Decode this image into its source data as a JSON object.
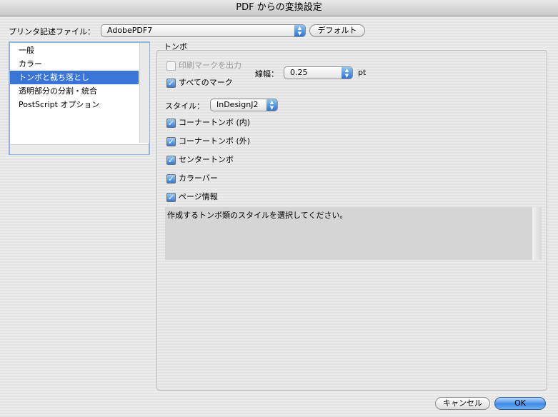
{
  "window": {
    "title": "PDF からの変換設定"
  },
  "printer": {
    "label": "プリンタ記述ファイル：",
    "selected": "AdobePDF7",
    "default_button": "デフォルト"
  },
  "sidebar": {
    "items": [
      {
        "label": "一般"
      },
      {
        "label": "カラー"
      },
      {
        "label": "トンボと裁ち落とし",
        "selected": true
      },
      {
        "label": "透明部分の分割・統合"
      },
      {
        "label": "PostScript オプション"
      }
    ]
  },
  "marks": {
    "group_title": "トンボ",
    "print_marks": {
      "label": "印刷マークを出力",
      "checked": false,
      "enabled": false
    },
    "all_marks": {
      "label": "すべてのマーク",
      "checked": true
    },
    "weight": {
      "label": "線幅：",
      "value": "0.25",
      "unit": "pt"
    },
    "style": {
      "label": "スタイル：",
      "value": "InDesignJ2"
    },
    "options": [
      {
        "label": "コーナートンボ (内)",
        "checked": true
      },
      {
        "label": "コーナートンボ (外)",
        "checked": true
      },
      {
        "label": "センタートンボ",
        "checked": true
      },
      {
        "label": "カラーバー",
        "checked": true
      },
      {
        "label": "ページ情報",
        "checked": true
      }
    ],
    "description": "作成するトンボ類のスタイルを選択してください。"
  },
  "footer": {
    "cancel": "キャンセル",
    "ok": "OK"
  },
  "icons": {
    "checkmark": "✓",
    "popup_arrows": "▲▼"
  },
  "colors": {
    "selection": "#3875d7",
    "accent": "#2c72d4"
  }
}
